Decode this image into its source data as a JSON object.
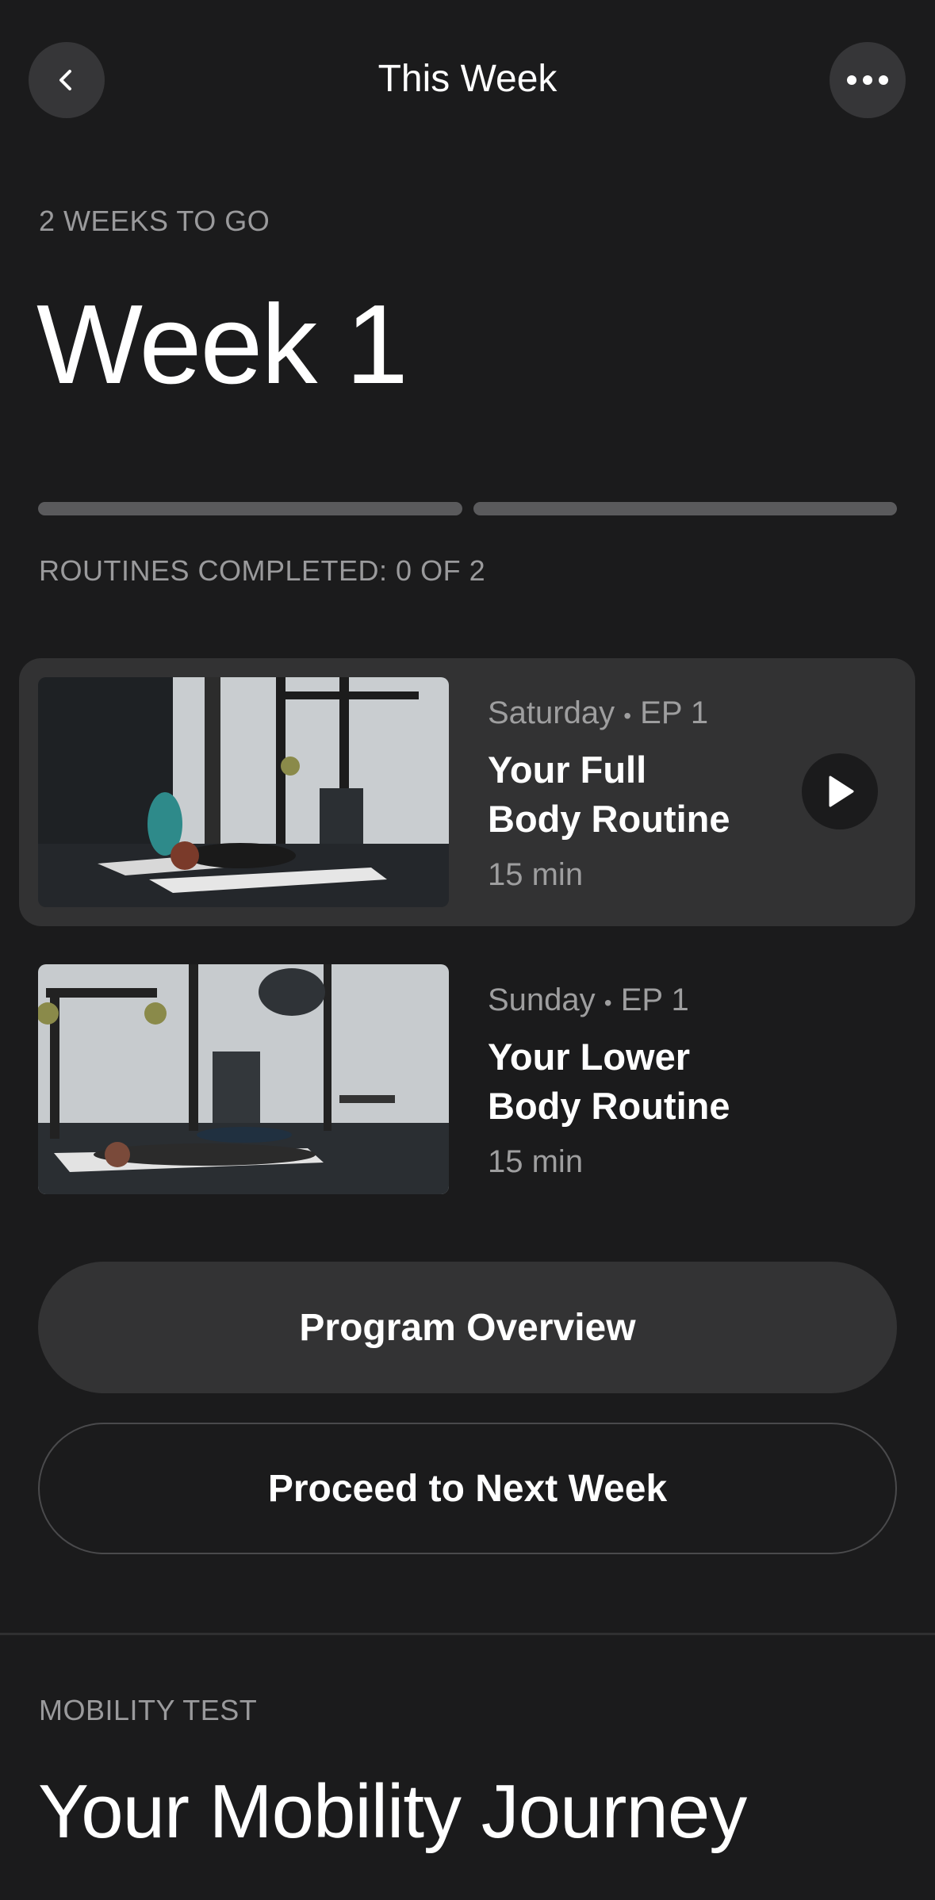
{
  "header": {
    "title": "This Week",
    "back_icon": "chevron-left-icon",
    "more_icon": "ellipsis-icon"
  },
  "week": {
    "eyebrow": "2 WEEKS TO GO",
    "title": "Week 1",
    "progress": {
      "segments": 2,
      "completed": 0
    },
    "routines_completed": "ROUTINES COMPLETED: 0 OF 2"
  },
  "routines": [
    {
      "day": "Saturday",
      "separator": "•",
      "episode": "EP 1",
      "title_line1": "Your Full",
      "title_line2": "Body Routine",
      "duration": "15 min",
      "active": true,
      "play_icon": "play-icon"
    },
    {
      "day": "Sunday",
      "separator": "•",
      "episode": "EP 1",
      "title_line1": "Your Lower",
      "title_line2": "Body Routine",
      "duration": "15 min",
      "active": false
    }
  ],
  "buttons": {
    "overview": "Program Overview",
    "next_week": "Proceed to Next Week"
  },
  "mobility": {
    "eyebrow": "MOBILITY TEST",
    "title": "Your Mobility Journey"
  },
  "colors": {
    "background": "#1b1b1c",
    "card": "#323233",
    "button": "#333334",
    "secondary_text": "#9a9a9c",
    "progress_track": "#5a5a5c"
  }
}
